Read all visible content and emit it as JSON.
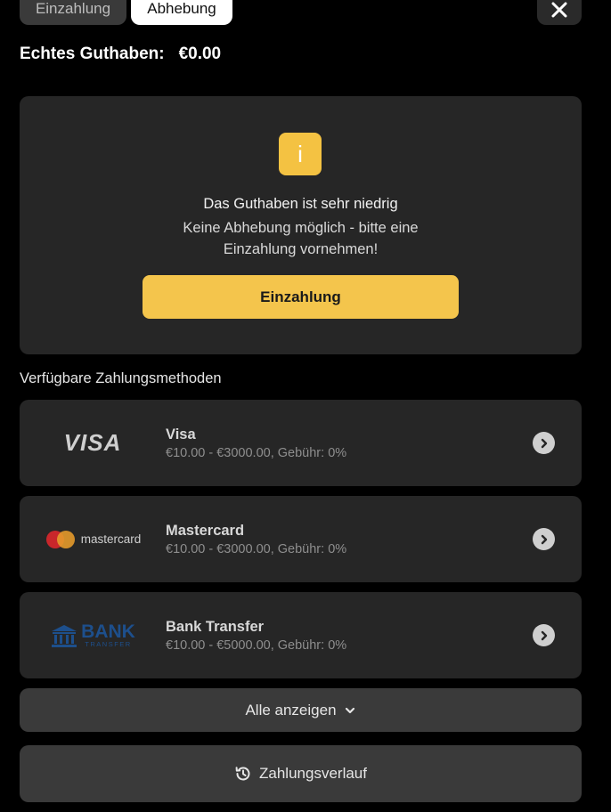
{
  "tabs": [
    {
      "label": "Einzahlung",
      "active": false
    },
    {
      "label": "Abhebung",
      "active": true
    }
  ],
  "close": {
    "icon": "close-icon"
  },
  "balance": {
    "label": "Echtes Guthaben:",
    "value": "€0.00"
  },
  "notice": {
    "icon_glyph": "i",
    "title": "Das Guthaben ist sehr niedrig",
    "line1": "Keine Abhebung möglich - bitte eine",
    "line2": "Einzahlung vornehmen!",
    "button_label": "Einzahlung"
  },
  "payment_methods": {
    "heading": "Verfügbare Zahlungsmethoden",
    "items": [
      {
        "logo_text": "VISA",
        "name": "Visa",
        "range": "€10.00 - €3000.00, Gebühr: 0%"
      },
      {
        "logo_text": "mastercard",
        "name": "Mastercard",
        "range": "€10.00 - €3000.00, Gebühr: 0%"
      },
      {
        "logo_text": "BANK",
        "logo_sub": "TRANSFER",
        "name": "Bank Transfer",
        "range": "€10.00 - €5000.00, Gebühr: 0%"
      }
    ]
  },
  "show_all": {
    "label": "Alle anzeigen"
  },
  "history": {
    "label": "Zahlungsverlauf"
  },
  "colors": {
    "accent": "#f4c54c",
    "card": "#262626",
    "background": "#000000"
  }
}
